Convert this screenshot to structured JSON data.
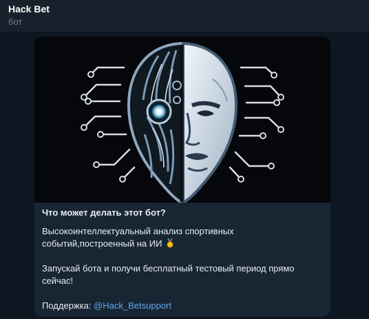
{
  "header": {
    "title": "Hack Bet",
    "subtitle": "бот"
  },
  "card": {
    "heading": "Что может делать этот бот?",
    "paragraph1": "Высокоинтеллектуальный анализ спортивных событий,построенный на ИИ",
    "paragraph2": "Запускай бота и получи бесплатный тестовый период прямо сейчас!",
    "support_label": "Поддержка: ",
    "support_link": "@Hack_Betsupport",
    "icon": "medal-icon"
  },
  "colors": {
    "background": "#0e1621",
    "header": "#17212b",
    "card": "#182533",
    "link": "#5fa8e8"
  }
}
